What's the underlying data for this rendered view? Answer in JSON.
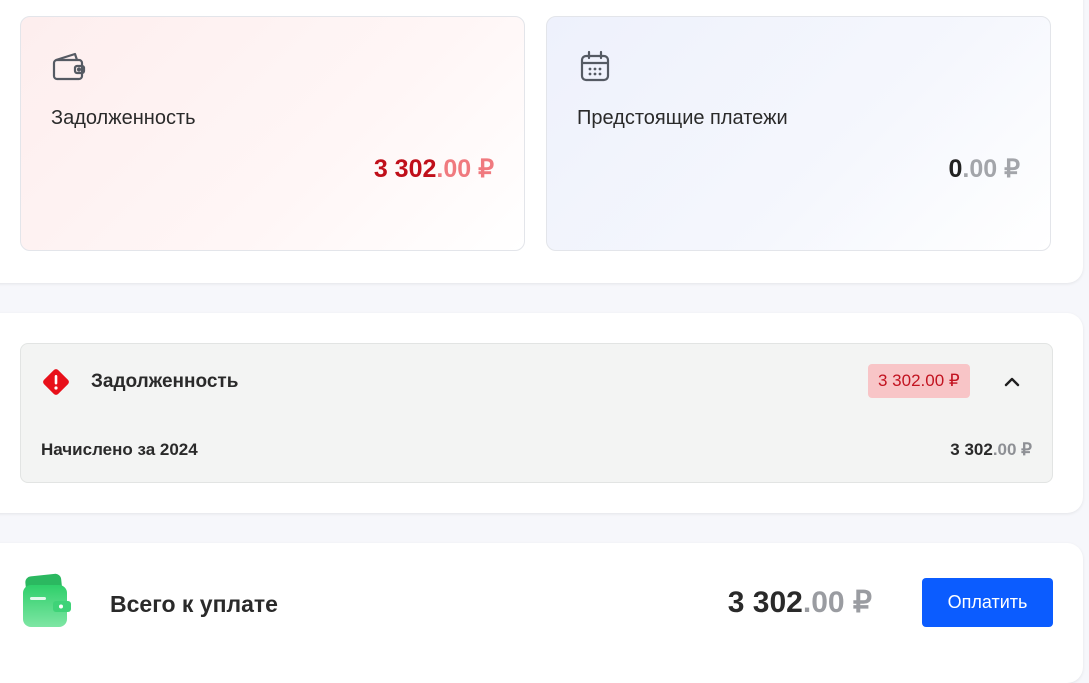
{
  "summary": {
    "debt_card": {
      "icon": "wallet-icon",
      "title": "Задолженность",
      "amount_int": "3 302",
      "amount_frac": ".00",
      "currency": " ₽",
      "colors": {
        "integer": "#c00f1a",
        "fraction": "#f07a7f"
      }
    },
    "upcoming_card": {
      "icon": "calendar-icon",
      "title": "Предстоящие платежи",
      "amount_int": "0",
      "amount_frac": ".00",
      "currency": " ₽"
    }
  },
  "debt_section": {
    "icon": "warning-diamond-icon",
    "title": "Задолженность",
    "badge": "3 302.00 ₽",
    "toggle_icon": "chevron-up-icon",
    "rows": [
      {
        "label": "Начислено за 2024",
        "amount_int": "3 302",
        "amount_frac": ".00",
        "currency": " ₽"
      }
    ]
  },
  "total": {
    "icon": "wallet-green-icon",
    "label": "Всего к уплате",
    "amount_int": "3 302",
    "amount_frac": ".00",
    "currency": " ₽",
    "pay_button_label": "Оплатить",
    "colors": {
      "pay_button": "#0b5cff",
      "error": "#c00f1a"
    }
  }
}
